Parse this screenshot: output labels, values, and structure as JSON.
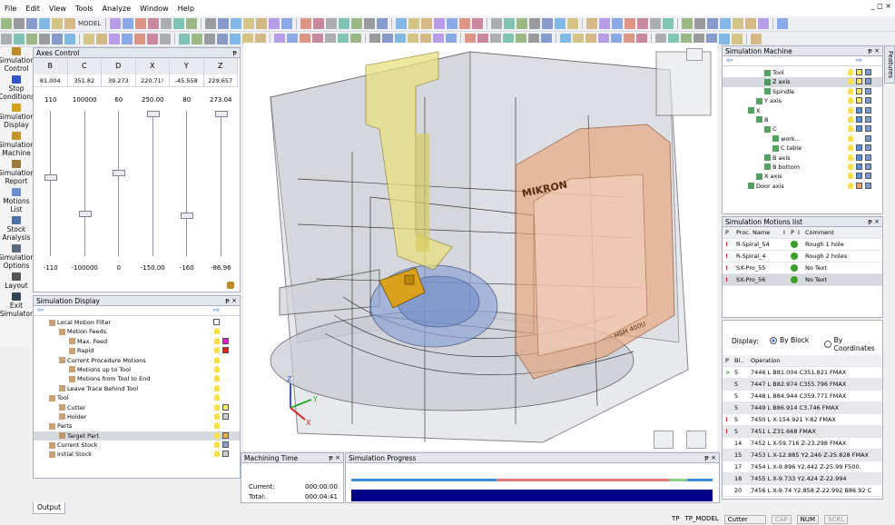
{
  "menu": [
    "File",
    "Edit",
    "View",
    "Tools",
    "Analyze",
    "Window",
    "Help"
  ],
  "window_controls": "_ ◻ ×",
  "toolbar": {
    "model_label": "MODEL"
  },
  "nav": [
    {
      "label": "Simulation Control",
      "icon": "simulation-control-icon",
      "color": "#c08a2a"
    },
    {
      "label": "Stop Conditions",
      "icon": "stop-conditions-icon",
      "color": "#3355cc"
    },
    {
      "label": "Simulation Display",
      "icon": "simulation-display-icon",
      "color": "#d4a017"
    },
    {
      "label": "Simulation Machine",
      "icon": "simulation-machine-icon",
      "color": "#c9942b"
    },
    {
      "label": "Simulation Report",
      "icon": "simulation-report-icon",
      "color": "#9b7b3a"
    },
    {
      "label": "Motions List",
      "icon": "motions-list-icon",
      "color": "#6a8fd0"
    },
    {
      "label": "Stock Analysis",
      "icon": "stock-analysis-icon",
      "color": "#4d6fa8"
    },
    {
      "label": "Simulation Options",
      "icon": "simulation-options-icon",
      "color": "#5b6b80"
    },
    {
      "label": "Layout",
      "icon": "layout-icon",
      "color": "#555555"
    },
    {
      "label": "Exit Simulator",
      "icon": "exit-simulator-icon",
      "color": "#345"
    }
  ],
  "axes_control": {
    "title": "Axes Control",
    "pin": "ᵽ",
    "columns": [
      "B",
      "C",
      "D",
      "X",
      "Y",
      "Z"
    ],
    "values": [
      "81.004",
      "351.82",
      "39.273",
      "220.71!",
      "-45.558",
      "229.657"
    ],
    "max": [
      "110",
      "100000",
      "60",
      "250.00",
      "80",
      "273.04"
    ],
    "min": [
      "-110",
      "-100000",
      "0",
      "-150.00",
      "-160",
      "-86.96"
    ],
    "thumb_levels": [
      0.45,
      0.71,
      0.42,
      0.0,
      0.72,
      0.0
    ]
  },
  "sim_display": {
    "title": "Simulation Display",
    "pin": "ᵽ ×",
    "items": [
      {
        "label": "Local Motion Filter",
        "indent": 1,
        "icon": "filter-icon",
        "check": true
      },
      {
        "label": "Motion Feeds",
        "indent": 2,
        "icon": "feeds-icon",
        "bulb": true
      },
      {
        "label": "Max. Feed",
        "indent": 3,
        "icon": "feeds-icon",
        "bulb": true,
        "swatch": "#e020c0"
      },
      {
        "label": "Rapid",
        "indent": 3,
        "icon": "feeds-icon",
        "bulb": true,
        "swatch": "#e02020"
      },
      {
        "label": "Current Procedure Motions",
        "indent": 2,
        "icon": "motions-icon",
        "bulb": true
      },
      {
        "label": "Motions up to Tool",
        "indent": 3,
        "icon": "motions-icon",
        "bulb": true
      },
      {
        "label": "Motions from Tool to End",
        "indent": 3,
        "icon": "motions-icon",
        "bulb": true
      },
      {
        "label": "Leave Trace Behind Tool",
        "indent": 2,
        "icon": "trace-icon",
        "bulb": true
      },
      {
        "label": "Tool",
        "indent": 1,
        "icon": "tool-icon",
        "bulb": true
      },
      {
        "label": "Cutter",
        "indent": 2,
        "icon": "cutter-icon",
        "bulb": true,
        "swatch": "#f5e66a"
      },
      {
        "label": "Holder",
        "indent": 2,
        "icon": "holder-icon",
        "bulb": true,
        "swatch": "#cfcfcf"
      },
      {
        "label": "Parts",
        "indent": 1,
        "icon": "parts-icon",
        "bulb": true
      },
      {
        "label": "Target Part",
        "indent": 2,
        "icon": "part-icon",
        "bulb": true,
        "swatch": "#e8b040",
        "selected": true
      },
      {
        "label": "Current Stock",
        "indent": 1,
        "icon": "stock-icon",
        "bulb": true,
        "swatch": "#8aa0c8"
      },
      {
        "label": "Initial Stock",
        "indent": 1,
        "icon": "stock-icon",
        "bulb": true,
        "swatch": "#cfcfcf"
      }
    ]
  },
  "sim_machine": {
    "title": "Simulation Machine",
    "pin": "ᵽ ×",
    "items": [
      {
        "label": "Tool",
        "indent": 4,
        "swatch": "#f5e66a"
      },
      {
        "label": "Z axis",
        "indent": 4,
        "swatch": "#f5e66a",
        "selected": true
      },
      {
        "label": "Spindle",
        "indent": 4,
        "swatch": "#f5e66a"
      },
      {
        "label": "Y axis",
        "indent": 3,
        "swatch": "#f5e66a"
      },
      {
        "label": "X",
        "indent": 2,
        "swatch": "#5b8fd6"
      },
      {
        "label": "B",
        "indent": 3,
        "swatch": "#5b8fd6"
      },
      {
        "label": "C",
        "indent": 4,
        "swatch": "#5b8fd6"
      },
      {
        "label": "work...",
        "indent": 5,
        "swatch": ""
      },
      {
        "label": "C table",
        "indent": 5,
        "swatch": "#5b8fd6"
      },
      {
        "label": "B axis",
        "indent": 4,
        "swatch": "#5b8fd6"
      },
      {
        "label": "B bottom",
        "indent": 4,
        "swatch": "#5b8fd6"
      },
      {
        "label": "X axis",
        "indent": 3,
        "swatch": "#5b8fd6"
      },
      {
        "label": "Door axis",
        "indent": 2,
        "swatch": "#e8a070"
      }
    ]
  },
  "motions_list": {
    "title": "Simulation Motions list",
    "pin": "ᵽ ×",
    "headers": [
      "P",
      "Proc. Name",
      "I",
      "P",
      "I",
      "Comment"
    ],
    "rows": [
      {
        "name": "R-Spiral_54",
        "comment": "Rough 1 hole",
        "selected": false
      },
      {
        "name": "R-Spiral_4",
        "comment": "Rough 2 holes",
        "selected": false
      },
      {
        "name": "SX-Pro_55",
        "comment": "No Text",
        "selected": false
      },
      {
        "name": "SX-Pro_56",
        "comment": "No Text",
        "selected": true
      }
    ]
  },
  "ops": {
    "display_label": "Display:",
    "by_block": "By Block",
    "by_coordinates": "By Coordinates",
    "headers": [
      "P",
      "Bl..",
      "Operation"
    ],
    "rows": [
      {
        "mark": ">",
        "bl": "5",
        "op": "7446 L B81.004 C351.821 FMAX",
        "shade": false
      },
      {
        "mark": "",
        "bl": "5",
        "op": "7447 L B82.974 C355.796 FMAX",
        "shade": true
      },
      {
        "mark": "",
        "bl": "5",
        "op": "7448 L B84.944 C359.771 FMAX",
        "shade": false
      },
      {
        "mark": "",
        "bl": "5",
        "op": "7449 L B86.914 C3.746 FMAX",
        "shade": true
      },
      {
        "mark": "!",
        "bl": "5",
        "op": "7450 L X-154.921 Y-82 FMAX",
        "shade": false
      },
      {
        "mark": "!",
        "bl": "5",
        "op": "7451 L Z31.668 FMAX",
        "shade": true
      },
      {
        "mark": "",
        "bl": "14",
        "op": "7452 L X-59.716 Z-23.298 FMAX",
        "shade": false
      },
      {
        "mark": "",
        "bl": "15",
        "op": "7453 L X-12.885 Y2.246 Z-25.828 FMAX",
        "shade": true
      },
      {
        "mark": "",
        "bl": "17",
        "op": "7454 L X-9.896 Y2.442 Z-25.99 F500.",
        "shade": false
      },
      {
        "mark": "",
        "bl": "18",
        "op": "7455 L X-9.733 Y2.424 Z-22.994",
        "shade": true
      },
      {
        "mark": "",
        "bl": "20",
        "op": "7456 L X-9.74 Y2.858 Z-22.992 B86.92 C",
        "shade": false
      }
    ]
  },
  "machining_time": {
    "title": "Machining Time",
    "pin": "ᵽ ×",
    "current_label": "Current:",
    "current": "000:00:00",
    "total_label": "Total:",
    "total": "000:04:41"
  },
  "progress": {
    "title": "Simulation Progress",
    "pin": "ᵽ ×"
  },
  "output_tab": "Output",
  "viewport": {
    "brand": "MIKRON",
    "model": "HSM 400U",
    "axis_x": "X",
    "axis_y": "Y",
    "axis_z": "Z"
  },
  "features_tab": "Features",
  "status": {
    "mode": "TP",
    "model": "TP_MODEL",
    "tool": "Cutter",
    "cap": "CAP",
    "num": "NUM",
    "scrl": "SCRL"
  }
}
